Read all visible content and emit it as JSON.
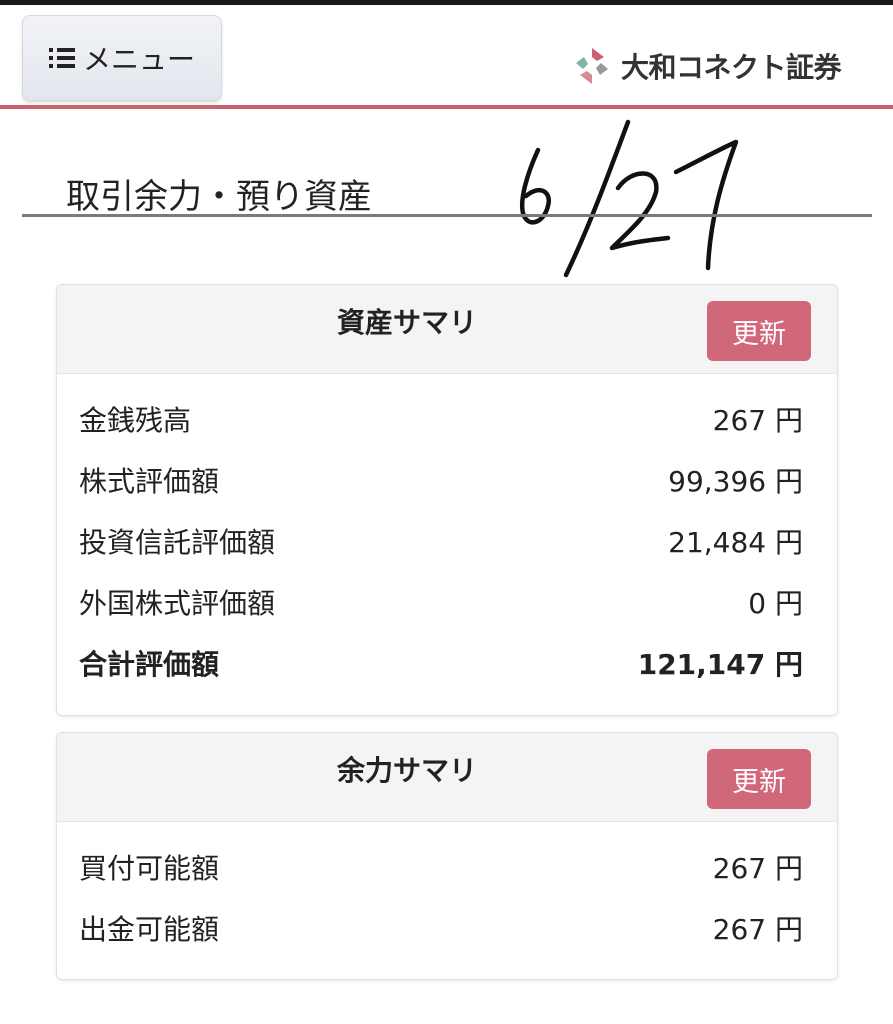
{
  "header": {
    "menu_label": "メニュー",
    "brand_name": "大和コネクト証券",
    "brand_colors": [
      "#c9616f",
      "#7db4a4",
      "#9a9a9a"
    ]
  },
  "page": {
    "title": "取引余力・預り資産",
    "handwritten_note": "6/27"
  },
  "asset_summary": {
    "title": "資産サマリ",
    "refresh_label": "更新",
    "rows": [
      {
        "label": "金銭残高",
        "value": "267 円"
      },
      {
        "label": "株式評価額",
        "value": "99,396 円"
      },
      {
        "label": "投資信託評価額",
        "value": "21,484 円"
      },
      {
        "label": "外国株式評価額",
        "value": "0 円"
      },
      {
        "label": "合計評価額",
        "value": "121,147 円"
      }
    ]
  },
  "capacity_summary": {
    "title": "余力サマリ",
    "refresh_label": "更新",
    "rows": [
      {
        "label": "買付可能額",
        "value": "267 円"
      },
      {
        "label": "出金可能額",
        "value": "267 円"
      }
    ]
  },
  "colors": {
    "accent": "#c9616f",
    "button": "#d0687a",
    "card_header": "#f4f4f4"
  }
}
